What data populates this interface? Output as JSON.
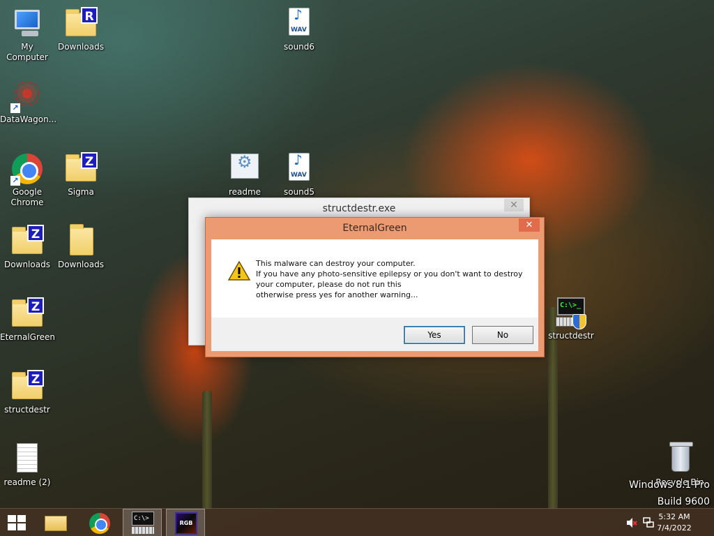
{
  "desktop": {
    "icons": [
      {
        "label": "My Computer"
      },
      {
        "label": "Downloads",
        "badge": "R"
      },
      {
        "label": "sound6",
        "ext": "WAV"
      },
      {
        "label": "DataWagon..."
      },
      {
        "label": "Google Chrome"
      },
      {
        "label": "Sigma",
        "badge": "Z"
      },
      {
        "label": "readme"
      },
      {
        "label": "sound5",
        "ext": "WAV"
      },
      {
        "label": "Downloads",
        "badge": "Z"
      },
      {
        "label": "Downloads"
      },
      {
        "label": "EternalGreen",
        "badge": "Z"
      },
      {
        "label": "structdestr",
        "badge": "Z"
      },
      {
        "label": "readme (2)"
      },
      {
        "label": "structdestr",
        "term": "C:\\>_"
      },
      {
        "label": "Recycle Bin"
      }
    ],
    "watermark": {
      "line1": "Windows 8.1 Pro",
      "line2": "Build 9600"
    }
  },
  "background_window": {
    "title": "structdestr.exe",
    "close_label": "✕"
  },
  "message_box": {
    "title": "EternalGreen",
    "close_label": "✕",
    "lines": [
      "This malware can destroy your computer.",
      "If you have any photo-sensitive epilepsy or you don't want to destroy",
      "your computer, please do not run this",
      "otherwise press yes for another warning..."
    ],
    "yes_label": "Yes",
    "no_label": "No"
  },
  "taskbar": {
    "term_text": "C:\\>",
    "rgb_text": "RGB",
    "time": "5:32 AM",
    "date": "7/4/2022"
  }
}
